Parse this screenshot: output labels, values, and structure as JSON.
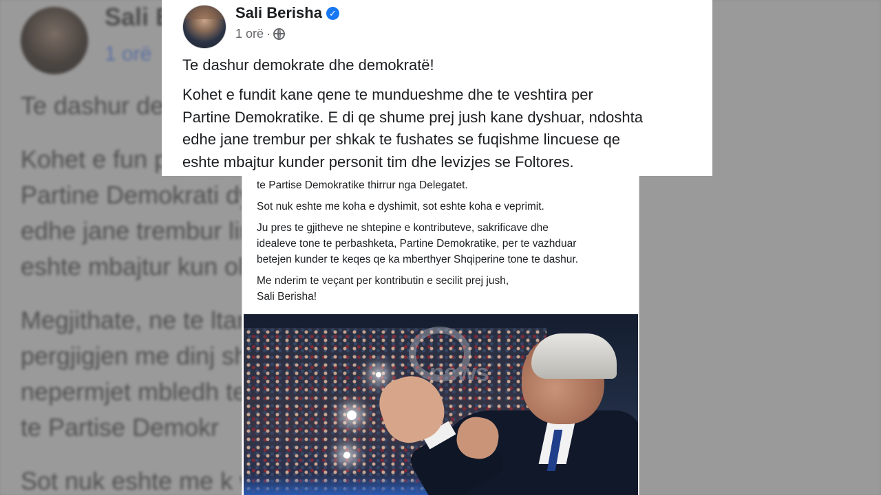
{
  "post": {
    "author": "Sali Berisha",
    "time": "1 orë",
    "greeting": "Te dashur demokrate dhe demokratë!",
    "paragraph_lines": [
      "Kohet e fundit kane qene te mundueshme dhe te veshtira per",
      "Partine Demokratike. E di qe shume prej jush kane dyshuar, ndoshta",
      "edhe jane trembur per shkak te fushates se fuqishme lincuese qe",
      "eshte mbajtur kunder personit tim dhe levizjes se Foltores."
    ]
  },
  "continuation": {
    "line1": "te Partise Demokratike thirrur nga Delegatet.",
    "line2": "Sot nuk eshte me koha e dyshimit, sot eshte koha e veprimit.",
    "para_lines": [
      "Ju pres te gjitheve ne shtepine e kontributeve, sakrificave dhe",
      "idealeve tone te perbashketa, Partine Demokratike, per te vazhduar",
      "betejen kunder te keqes qe ka mberthyer Shqiperine tone te dashur."
    ],
    "closing": "Me nderim te veçant per kontributin e secilit prej jush,",
    "signature": "Sali Berisha!"
  },
  "background": {
    "name": "Sali B",
    "time": "1 orë",
    "lines": [
      "Te dashur de",
      "Kohet e fun                                                                                          per",
      "Partine Demokrati                                                                            dyshuar, ndoshta",
      "edhe jane trembur                                                                              lincuese qe",
      "eshte mbajtur kun                                                                                oltores.",
      "Megjithate, ne te                                                                           ltante u dhame",
      "pergjigjen me dinj                                                                           shtore dje",
      "nepermjet mbledh                                                                          te Rithemelimit",
      "te Partise Demokr",
      "Sot nuk eshte me k                                                                            veprimit."
    ]
  },
  "watermark": "news",
  "colors": {
    "verified": "#1877f2",
    "link": "#65676b"
  },
  "icons": [
    "verified-badge-icon",
    "globe-icon"
  ]
}
